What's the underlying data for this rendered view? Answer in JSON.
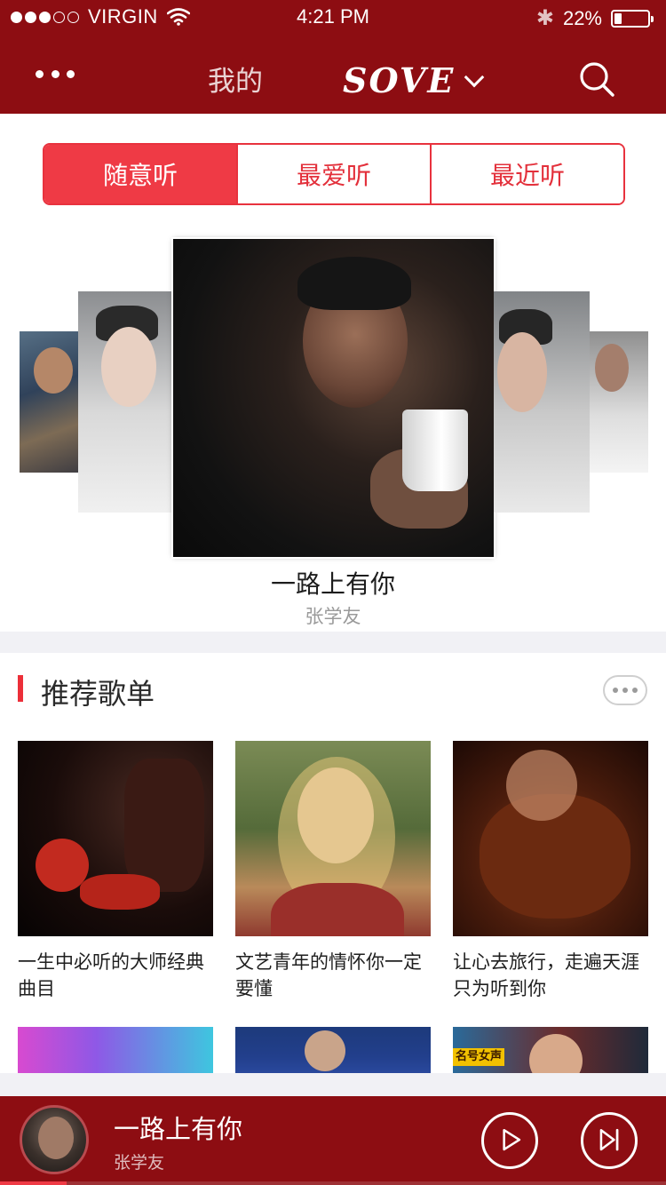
{
  "status_bar": {
    "carrier": "VIRGIN",
    "time": "4:21 PM",
    "battery_text": "22%",
    "battery_level": 0.22,
    "signal_bars_filled": 3,
    "signal_bars_total": 5
  },
  "nav": {
    "mine_label": "我的",
    "brand": "SOVE"
  },
  "tabs": [
    {
      "label": "随意听",
      "active": true
    },
    {
      "label": "最爱听",
      "active": false
    },
    {
      "label": "最近听",
      "active": false
    }
  ],
  "featured": {
    "title": "一路上有你",
    "artist": "张学友"
  },
  "recommend": {
    "title": "推荐歌单",
    "playlists": [
      {
        "title": "一生中必听的大师经典曲目"
      },
      {
        "title": "文艺青年的情怀你一定要懂"
      },
      {
        "title": "让心去旅行，走遍天涯只为听到你"
      }
    ],
    "partial_badge": "名号女声"
  },
  "player": {
    "title": "一路上有你",
    "artist": "张学友",
    "progress": 0.1
  },
  "colors": {
    "brand_red": "#8d0d12",
    "accent_red": "#ef3a45",
    "tab_border": "#e8323e"
  },
  "icons": {
    "more": "more-dots-icon",
    "search": "search-icon",
    "brand_dropdown": "chevron-down-icon",
    "play": "play-icon",
    "next": "skip-next-icon",
    "section_more": "more-dots-icon"
  }
}
